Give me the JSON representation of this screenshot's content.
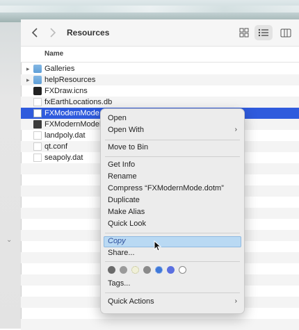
{
  "toolbar": {
    "title": "Resources"
  },
  "list": {
    "column_header": "Name",
    "items": [
      {
        "name": "Galleries",
        "type": "folder",
        "expandable": true
      },
      {
        "name": "helpResources",
        "type": "folder",
        "expandable": true
      },
      {
        "name": "FXDraw.icns",
        "type": "icns",
        "expandable": false
      },
      {
        "name": "fxEarthLocations.db",
        "type": "file",
        "expandable": false
      },
      {
        "name": "FXModernMode.d",
        "type": "word-doc",
        "expandable": false,
        "selected": true
      },
      {
        "name": "FXModernModeM",
        "type": "word-doc",
        "expandable": false
      },
      {
        "name": "landpoly.dat",
        "type": "file",
        "expandable": false
      },
      {
        "name": "qt.conf",
        "type": "file",
        "expandable": false
      },
      {
        "name": "seapoly.dat",
        "type": "file",
        "expandable": false
      }
    ]
  },
  "context_menu": {
    "open": "Open",
    "open_with": "Open With",
    "move_to_bin": "Move to Bin",
    "get_info": "Get Info",
    "rename": "Rename",
    "compress": "Compress “FXModernMode.dotm”",
    "duplicate": "Duplicate",
    "make_alias": "Make Alias",
    "quick_look": "Quick Look",
    "copy": "Copy",
    "share": "Share...",
    "tags": "Tags...",
    "quick_actions": "Quick Actions",
    "tag_colors": [
      "#6a6a6a",
      "#9a9a9a",
      "#f0f0d8",
      "#8a8a8a",
      "#3f78d8",
      "#5a6fe0",
      "#ffffff"
    ]
  },
  "colors": {
    "selection": "#2f5bdd",
    "copy_highlight": "#b9d9f3"
  }
}
